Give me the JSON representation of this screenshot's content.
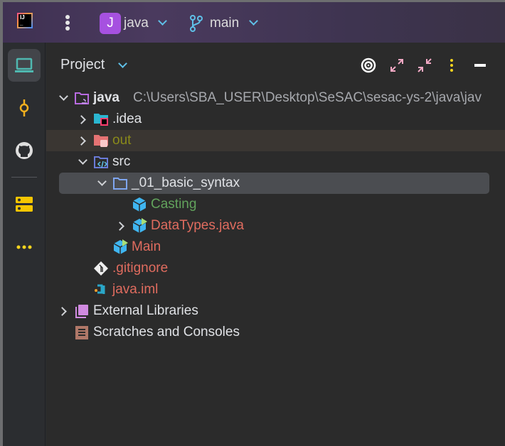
{
  "header": {
    "project_badge": "J",
    "project_name": "java",
    "branch": "main"
  },
  "colors": {
    "accent": "#5fc0e8",
    "selected_row": "#4b4d51",
    "ignored_row": "#3a3632",
    "modified": "#e06c5f",
    "added": "#62a35c",
    "excluded": "#8a8a1a"
  },
  "sidebar": {
    "items": [
      {
        "name": "project",
        "icon": "laptop-icon",
        "active": true
      },
      {
        "name": "commit",
        "icon": "commit-icon"
      },
      {
        "name": "github",
        "icon": "github-icon"
      },
      {
        "name": "services",
        "icon": "server-icon"
      },
      {
        "name": "more",
        "icon": "more-icon"
      }
    ]
  },
  "panel": {
    "title": "Project",
    "toolbar": [
      "target-icon",
      "expand-icon",
      "collapse-icon",
      "options-icon",
      "minimize-icon"
    ],
    "tree": [
      {
        "label": "java",
        "path": "C:\\Users\\SBA_USER\\Desktop\\SeSAC\\sesac-ys-2\\java\\jav",
        "level": 0,
        "expanded": true,
        "icon": "module-folder-icon"
      },
      {
        "label": ".idea",
        "level": 1,
        "expanded": false,
        "icon": "idea-folder-icon"
      },
      {
        "label": "out",
        "level": 1,
        "expanded": false,
        "icon": "excluded-folder-icon"
      },
      {
        "label": "src",
        "level": 1,
        "expanded": true,
        "icon": "source-folder-icon"
      },
      {
        "label": "_01_basic_syntax",
        "level": 2,
        "expanded": true,
        "icon": "package-folder-icon",
        "selected": true
      },
      {
        "label": "Casting",
        "level": 3,
        "icon": "java-class-icon"
      },
      {
        "label": "DataTypes.java",
        "level": 3,
        "expanded": false,
        "icon": "java-class-runnable-icon"
      },
      {
        "label": "Main",
        "level": 2,
        "icon": "java-class-runnable-icon"
      },
      {
        "label": ".gitignore",
        "level": 1,
        "icon": "git-icon"
      },
      {
        "label": "java.iml",
        "level": 1,
        "icon": "iml-icon"
      },
      {
        "label": "External Libraries",
        "level": 0,
        "expanded": false,
        "icon": "library-icon"
      },
      {
        "label": "Scratches and Consoles",
        "level": 0,
        "icon": "scratches-icon"
      }
    ]
  }
}
